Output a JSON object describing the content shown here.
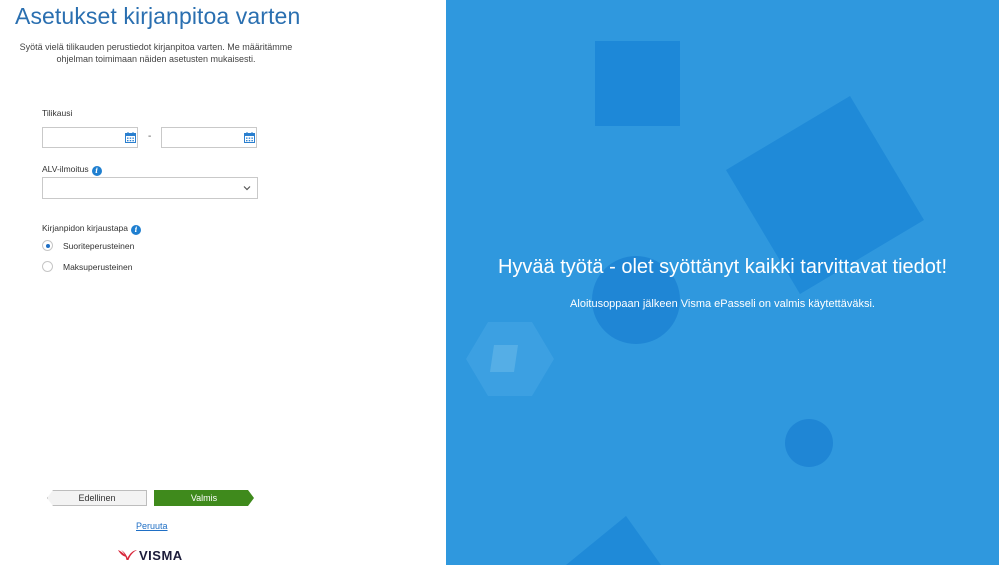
{
  "form": {
    "title": "Asetukset kirjanpitoa varten",
    "intro_line1": "Syötä vielä tilikauden perustiedot kirjanpitoa varten. Me määritämme",
    "intro_line2": "ohjelman toimimaan näiden asetusten mukaisesti.",
    "fiscal_period_label": "Tilikausi",
    "date_separator": "-",
    "start_date_value": "",
    "end_date_value": "",
    "vat_label": "ALV-ilmoitus",
    "vat_selected": "",
    "bookkeeping_label": "Kirjanpidon kirjaustapa",
    "options": [
      {
        "label": "Suoriteperusteinen",
        "selected": true
      },
      {
        "label": "Maksuperusteinen",
        "selected": false
      }
    ],
    "prev_button": "Edellinen",
    "done_button": "Valmis",
    "cancel_link": "Peruuta",
    "logo_text": "VISMA"
  },
  "promo": {
    "headline": "Hyvää työtä - olet syöttänyt kaikki tarvittavat tiedot!",
    "subline": "Aloitusoppaan jälkeen Visma ePasseli on valmis käytettäväksi."
  },
  "colors": {
    "accent_blue": "#2f98de",
    "title_blue": "#2a6fb0",
    "done_green": "#3f8a1c",
    "logo_red": "#d8263a"
  },
  "icons": [
    "calendar-icon",
    "info-icon",
    "chevron-down-icon",
    "visma-logo-icon"
  ]
}
